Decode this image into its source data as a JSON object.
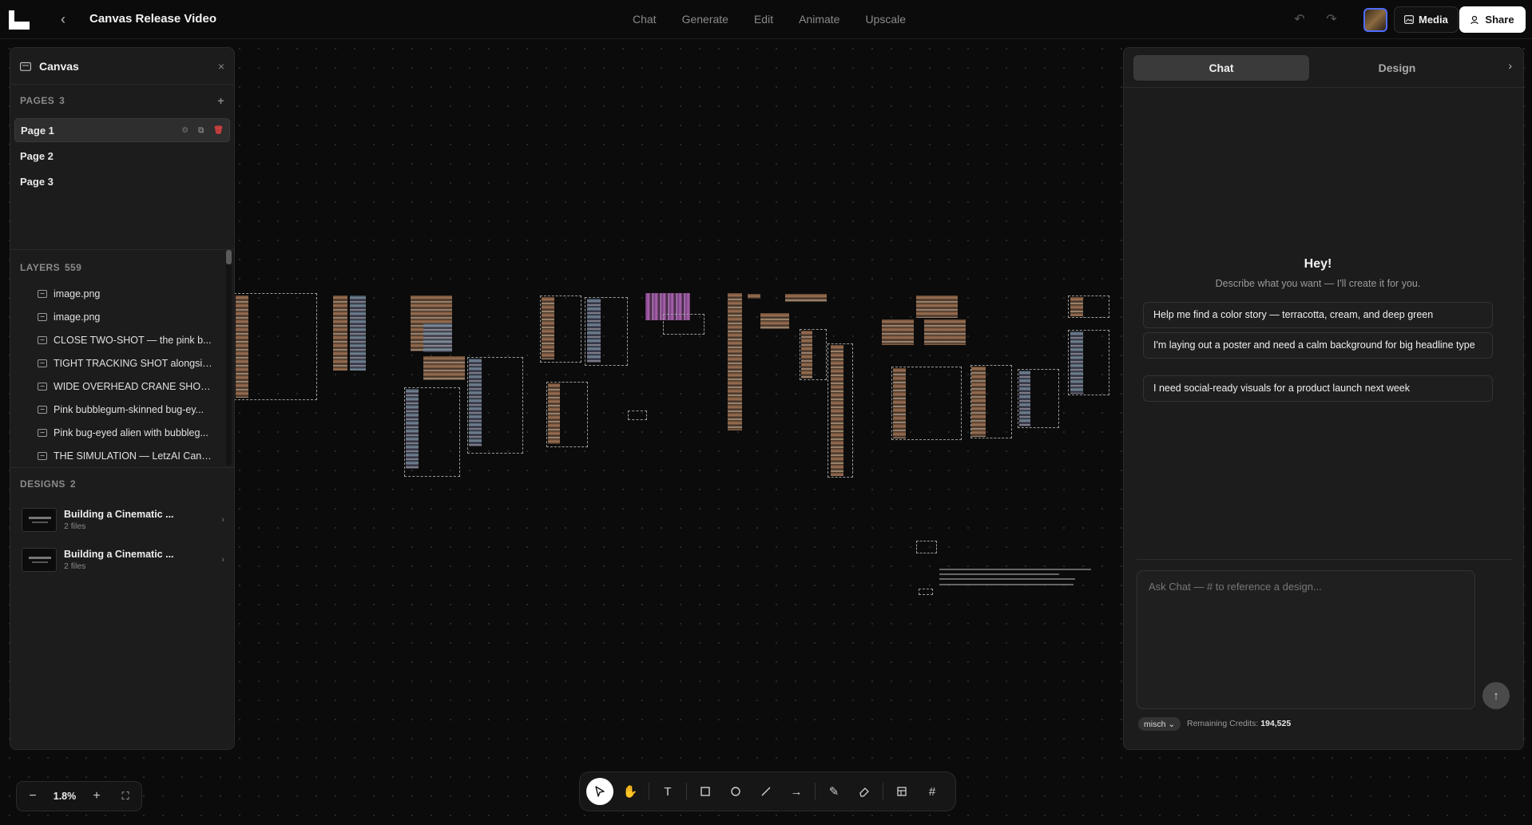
{
  "topbar": {
    "title": "Canvas Release Video",
    "tabs": [
      "Chat",
      "Generate",
      "Edit",
      "Animate",
      "Upscale"
    ],
    "media_label": "Media",
    "share_label": "Share"
  },
  "left_panel": {
    "title": "Canvas",
    "pages_label": "PAGES",
    "pages_count": "3",
    "pages": [
      "Page 1",
      "Page 2",
      "Page 3"
    ],
    "layers_label": "LAYERS",
    "layers_count": "559",
    "layers": [
      "image.png",
      "image.png",
      "CLOSE TWO-SHOT — the pink b...",
      "TIGHT TRACKING SHOT alongsid...",
      "WIDE OVERHEAD CRANE SHOT l...",
      "Pink bubblegum-skinned bug-ey...",
      "Pink bug-eyed alien with bubbleg...",
      "THE SIMULATION — LetzAI Canv..."
    ],
    "designs_label": "DESIGNS",
    "designs_count": "2",
    "designs": [
      {
        "name": "Building a Cinematic ...",
        "files": "2 files"
      },
      {
        "name": "Building a Cinematic ...",
        "files": "2 files"
      }
    ]
  },
  "right_panel": {
    "tabs": [
      "Chat",
      "Design"
    ],
    "greeting": "Hey!",
    "subtitle": "Describe what you want — I'll create it for you.",
    "suggestions": [
      "Help me find a color story — terracotta, cream, and deep green",
      "I'm laying out a poster and need a calm background for big headline type",
      "I need social-ready visuals for a product launch next week"
    ],
    "input_placeholder": "Ask Chat — # to reference a design...",
    "model": "misch",
    "credits_label": "Remaining Credits:",
    "credits_value": "194,525"
  },
  "zoom": {
    "value": "1.8%"
  },
  "toolbar_tools": [
    "select-tool",
    "hand-tool",
    "text-tool",
    "rectangle-tool",
    "ellipse-tool",
    "line-tool",
    "arrow-tool",
    "pencil-tool",
    "eraser-tool",
    "frame-tool",
    "grid-tool"
  ],
  "colors": {
    "accent": "#4f6cff",
    "danger": "#d94040",
    "background": "#0b0b0b",
    "panel": "#1c1c1c"
  }
}
